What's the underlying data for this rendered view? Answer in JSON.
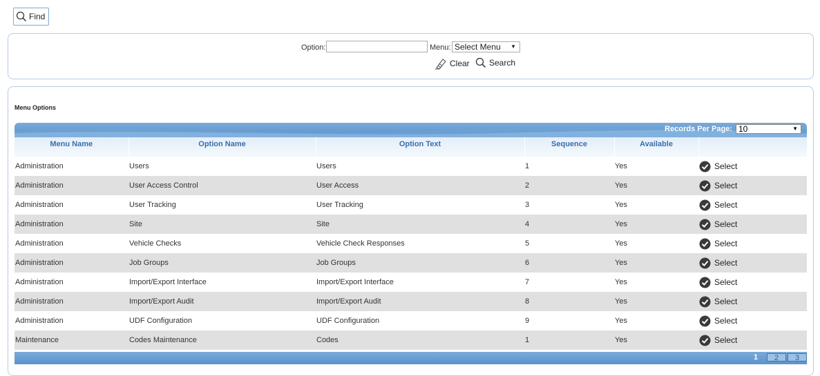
{
  "toolbar": {
    "find_label": "Find"
  },
  "search": {
    "option_label": "Option:",
    "option_value": "",
    "menu_label": "Menu:",
    "menu_selected": "Select Menu",
    "clear_label": "Clear",
    "search_label": "Search"
  },
  "results": {
    "section_title": "Menu Options",
    "records_per_page_label": "Records Per Page:",
    "records_per_page_value": "10",
    "columns": [
      "Menu Name",
      "Option Name",
      "Option Text",
      "Sequence",
      "Available",
      ""
    ],
    "rows": [
      {
        "menu": "Administration",
        "option": "Users",
        "text": "Users",
        "sequence": "1",
        "available": "Yes",
        "action": "Select"
      },
      {
        "menu": "Administration",
        "option": "User Access Control",
        "text": "User Access",
        "sequence": "2",
        "available": "Yes",
        "action": "Select"
      },
      {
        "menu": "Administration",
        "option": "User Tracking",
        "text": "User Tracking",
        "sequence": "3",
        "available": "Yes",
        "action": "Select"
      },
      {
        "menu": "Administration",
        "option": "Site",
        "text": "Site",
        "sequence": "4",
        "available": "Yes",
        "action": "Select"
      },
      {
        "menu": "Administration",
        "option": "Vehicle Checks",
        "text": "Vehicle Check Responses",
        "sequence": "5",
        "available": "Yes",
        "action": "Select"
      },
      {
        "menu": "Administration",
        "option": "Job Groups",
        "text": "Job Groups",
        "sequence": "6",
        "available": "Yes",
        "action": "Select"
      },
      {
        "menu": "Administration",
        "option": "Import/Export Interface",
        "text": "Import/Export Interface",
        "sequence": "7",
        "available": "Yes",
        "action": "Select"
      },
      {
        "menu": "Administration",
        "option": "Import/Export Audit",
        "text": "Import/Export Audit",
        "sequence": "8",
        "available": "Yes",
        "action": "Select"
      },
      {
        "menu": "Administration",
        "option": "UDF Configuration",
        "text": "UDF Configuration",
        "sequence": "9",
        "available": "Yes",
        "action": "Select"
      },
      {
        "menu": "Maintenance",
        "option": "Codes Maintenance",
        "text": "Codes",
        "sequence": "1",
        "available": "Yes",
        "action": "Select"
      }
    ],
    "pages": [
      "1",
      "2",
      "3"
    ],
    "current_page": "1"
  },
  "icons": {
    "find": "search-icon",
    "clear": "eraser-icon",
    "search": "search-icon",
    "select": "check-circle-icon"
  },
  "colors": {
    "header_blue": "#5b93cc",
    "column_header_text": "#3d6ea8",
    "panel_border": "#b6cde6",
    "alt_row": "#e0e0e0"
  }
}
